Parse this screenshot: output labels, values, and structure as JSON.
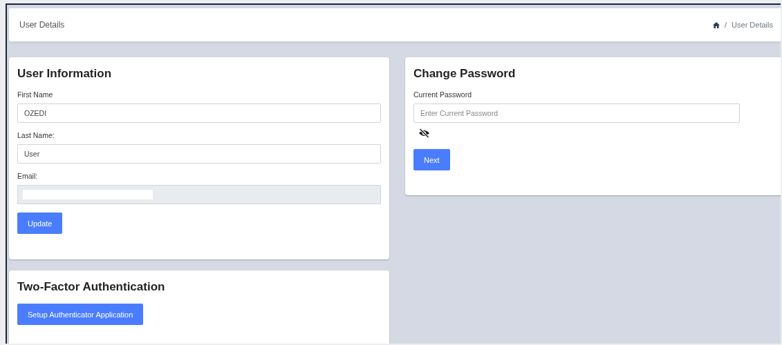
{
  "header": {
    "title": "User Details",
    "breadcrumb": [
      {
        "kind": "home"
      },
      {
        "kind": "text",
        "label": "User Details"
      }
    ],
    "separator": "/"
  },
  "user_information": {
    "title": "User Information",
    "fields": [
      {
        "label": "First Name",
        "value": "OZEDI",
        "disabled": false,
        "redacted": false
      },
      {
        "label": "Last Name:",
        "value": "User",
        "disabled": false,
        "redacted": false
      },
      {
        "label": "Email:",
        "disabled": true,
        "redacted": true
      }
    ],
    "button": "Update"
  },
  "two_factor": {
    "title": "Two-Factor Authentication",
    "button": "Setup Authenticator Application"
  },
  "change_password": {
    "title": "Change Password",
    "field": {
      "label": "Current Password",
      "placeholder": "Enter Current Password"
    },
    "password_visible": false,
    "button": "Next"
  }
}
